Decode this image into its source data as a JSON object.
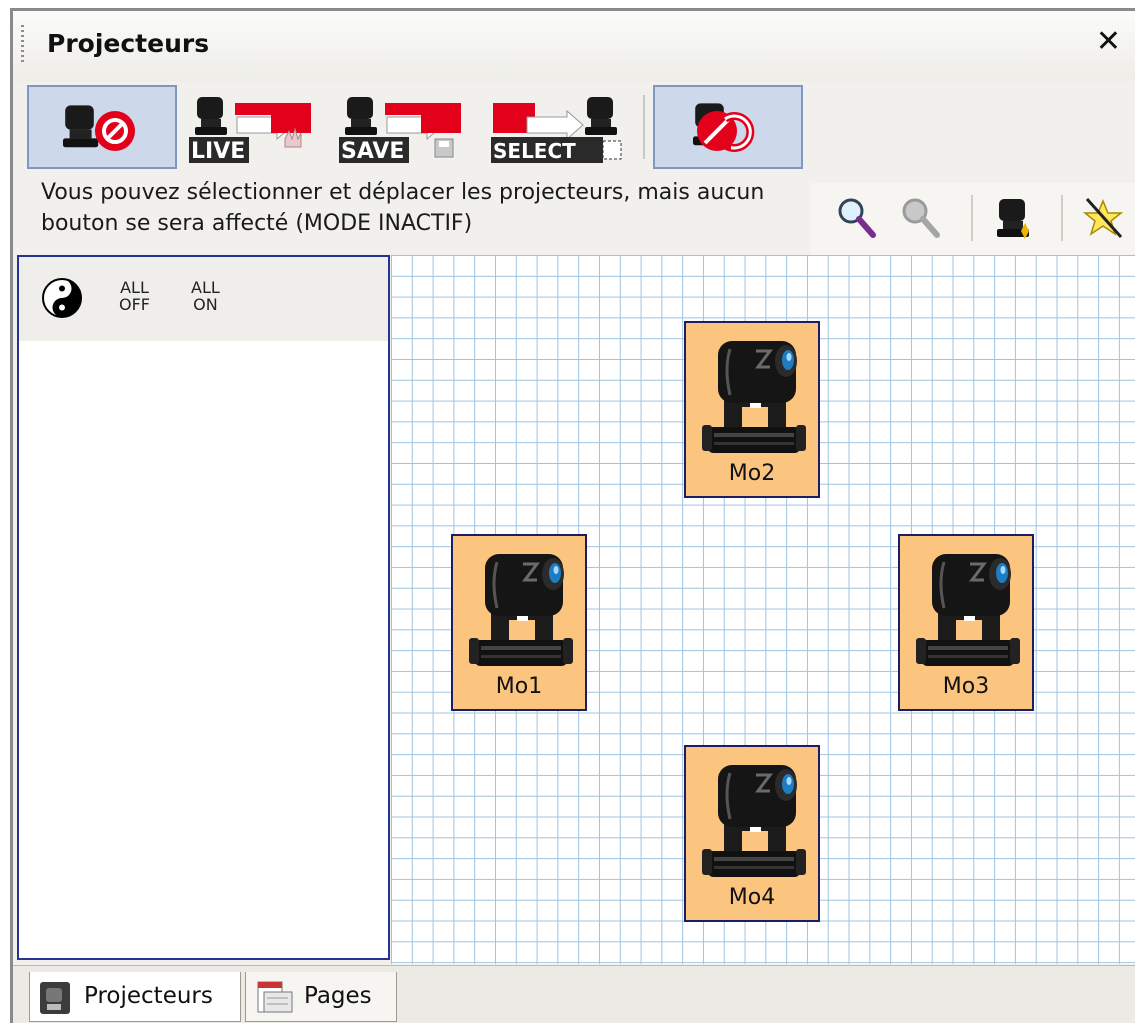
{
  "window": {
    "title": "Projecteurs",
    "close_glyph": "✕"
  },
  "toolbar": {
    "buttons": [
      {
        "name": "inactive-mode-button",
        "icon": "projector-forbidden-icon",
        "selected": true
      },
      {
        "name": "live-mode-button",
        "icon": "live-mode-icon",
        "text": "LIVE",
        "selected": false
      },
      {
        "name": "save-mode-button",
        "icon": "save-mode-icon",
        "text": "SAVE",
        "selected": false
      },
      {
        "name": "select-mode-button",
        "icon": "select-mode-icon",
        "text": "SELECT",
        "selected": false
      },
      {
        "name": "release-mode-button",
        "icon": "projector-release-icon",
        "selected": true
      }
    ]
  },
  "hint": "Vous pouvez sélectionner et déplacer les projecteurs, mais aucun bouton se sera affecté (MODE INACTIF)",
  "tools": [
    "zoom-in-icon",
    "zoom-out-icon",
    "add-projector-icon",
    "clear-selection-icon"
  ],
  "left_panel": {
    "yin_yang_icon": "yin-yang-icon",
    "all_off": {
      "line1": "ALL",
      "line2": "OFF"
    },
    "all_on": {
      "line1": "ALL",
      "line2": "ON"
    }
  },
  "fixtures": [
    {
      "name": "fixture-mo2",
      "label": "Mo2"
    },
    {
      "name": "fixture-mo1",
      "label": "Mo1"
    },
    {
      "name": "fixture-mo3",
      "label": "Mo3"
    },
    {
      "name": "fixture-mo4",
      "label": "Mo4"
    }
  ],
  "tabs": [
    {
      "label": "Projecteurs",
      "icon": "projector-tab-icon",
      "active": true
    },
    {
      "label": "Pages",
      "icon": "pages-tab-icon",
      "active": false
    }
  ],
  "colors": {
    "fixture_fill": "#fcc57f",
    "fixture_border": "#1b1d66",
    "grid_line": "#9fc4e0",
    "selected_button": "#cdd8ea",
    "warning_red": "#e3001b"
  }
}
